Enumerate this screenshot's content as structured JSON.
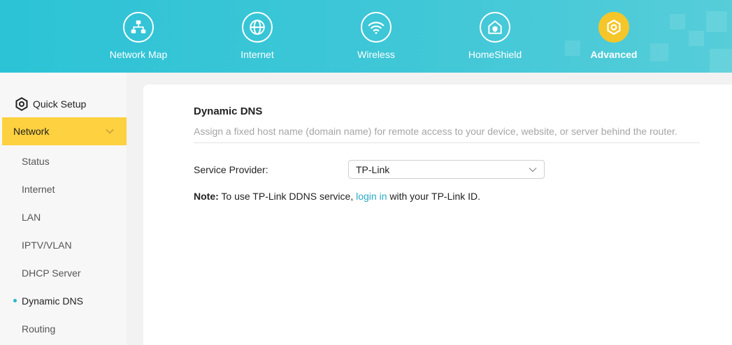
{
  "top_nav": {
    "items": [
      {
        "label": "Network Map",
        "icon": "network-map-icon"
      },
      {
        "label": "Internet",
        "icon": "globe-icon"
      },
      {
        "label": "Wireless",
        "icon": "wifi-icon"
      },
      {
        "label": "HomeShield",
        "icon": "home-shield-icon"
      },
      {
        "label": "Advanced",
        "icon": "gear-icon",
        "active": true
      }
    ]
  },
  "sidebar": {
    "quick_setup": "Quick Setup",
    "network": "Network",
    "items": [
      "Status",
      "Internet",
      "LAN",
      "IPTV/VLAN",
      "DHCP Server",
      "Dynamic DNS",
      "Routing"
    ],
    "active_item": "Dynamic DNS"
  },
  "content": {
    "title": "Dynamic DNS",
    "description": "Assign a fixed host name (domain name) for remote access to your device, website, or server behind the router.",
    "service_provider_label": "Service Provider:",
    "service_provider_value": "TP-Link",
    "note_prefix": "Note:",
    "note_text_1": " To use TP-Link DDNS service, ",
    "note_link": "login in",
    "note_text_2": " with your TP-Link ID."
  },
  "colors": {
    "header": "#2cc3d6",
    "accent_yellow": "#fdd13f",
    "link": "#2aa9c4"
  }
}
